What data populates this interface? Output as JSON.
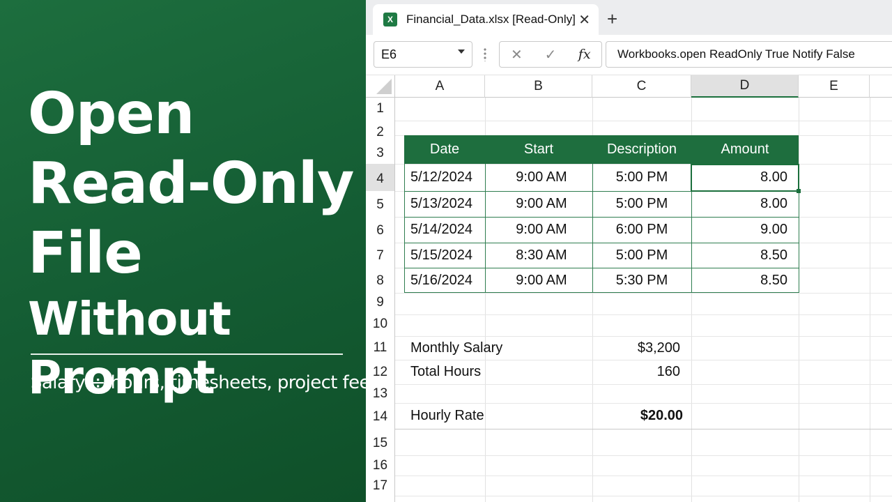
{
  "promo": {
    "title_line1": "Open",
    "title_line2": "Read-Only",
    "title_line3": "File",
    "title_line4": "Without Prompt",
    "subtitle": "Salary ÷ hours, timesheets, project fees",
    "bg_color": "#1b6b3a"
  },
  "window": {
    "tab_title": "Financial_Data.xlsx [Read-Only]",
    "app_icon": "excel-icon",
    "close_glyph": "✕",
    "new_tab_glyph": "+"
  },
  "formula_bar": {
    "name_box": "E6",
    "cancel_glyph": "✕",
    "enter_glyph": "✓",
    "fx_label": "fx",
    "formula": "Workbooks.open ReadOnly True Notify False"
  },
  "grid": {
    "columns": [
      "A",
      "B",
      "C",
      "D",
      "E"
    ],
    "selected_column": "D",
    "rows": [
      "1",
      "2",
      "3",
      "4",
      "5",
      "6",
      "7",
      "8",
      "9",
      "10",
      "11",
      "12",
      "13",
      "14",
      "15",
      "16",
      "17"
    ],
    "selected_row": "4"
  },
  "table": {
    "headers": [
      "Date",
      "Start",
      "Description",
      "Amount"
    ],
    "rows": [
      [
        "5/12/2024",
        "9:00 AM",
        "5:00 PM",
        "8.00"
      ],
      [
        "5/13/2024",
        "9:00 AM",
        "5:00 PM",
        "8.00"
      ],
      [
        "5/14/2024",
        "9:00 AM",
        "6:00 PM",
        "9.00"
      ],
      [
        "5/15/2024",
        "8:30 AM",
        "5:00 PM",
        "8.50"
      ],
      [
        "5/16/2024",
        "9:00 AM",
        "5:30 PM",
        "8.50"
      ]
    ],
    "header_color": "#1e6e3e"
  },
  "summary": {
    "salary_label": "Monthly Salary",
    "salary_value": "$3,200",
    "hours_label": "Total Hours",
    "hours_value": "160",
    "rate_label": "Hourly Rate",
    "rate_value": "$20.00"
  }
}
